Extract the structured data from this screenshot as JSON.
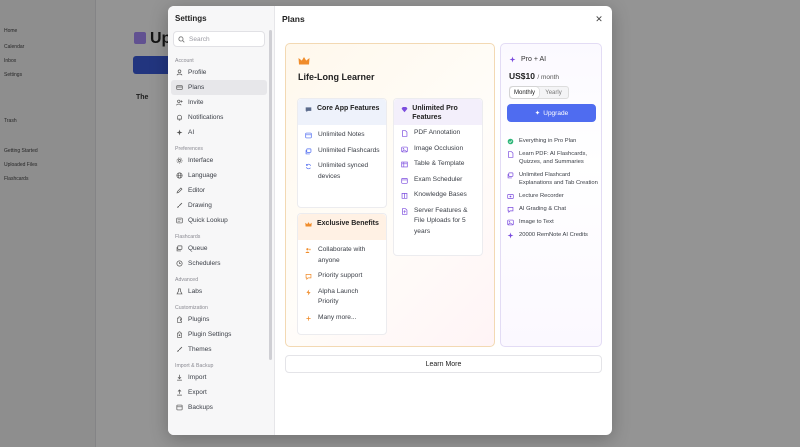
{
  "background": {
    "title": "Up",
    "subtitle": "The",
    "left_rows": [
      "",
      "Home",
      "Calendar",
      "Inbox",
      "Settings",
      "",
      "",
      "Trash",
      "",
      "",
      "Getting Started",
      "Uploaded Files",
      "Flashcards"
    ]
  },
  "settings": {
    "title": "Settings",
    "search_placeholder": "Search",
    "sections": [
      {
        "title": "Account",
        "items": [
          {
            "label": "Profile",
            "icon": "user-icon"
          },
          {
            "label": "Plans",
            "icon": "card-icon",
            "active": true
          },
          {
            "label": "Invite",
            "icon": "add-user-icon"
          },
          {
            "label": "Notifications",
            "icon": "bell-icon"
          },
          {
            "label": "AI",
            "icon": "sparkle-icon"
          }
        ]
      },
      {
        "title": "Preferences",
        "items": [
          {
            "label": "Interface",
            "icon": "settings-icon"
          },
          {
            "label": "Language",
            "icon": "globe-icon"
          },
          {
            "label": "Editor",
            "icon": "pen-icon"
          },
          {
            "label": "Drawing",
            "icon": "brush-icon"
          },
          {
            "label": "Quick Lookup",
            "icon": "lookup-icon"
          }
        ]
      },
      {
        "title": "Flashcards",
        "items": [
          {
            "label": "Queue",
            "icon": "queue-icon"
          },
          {
            "label": "Schedulers",
            "icon": "clock-icon"
          }
        ]
      },
      {
        "title": "Advanced",
        "items": [
          {
            "label": "Labs",
            "icon": "flask-icon"
          }
        ]
      },
      {
        "title": "Customization",
        "items": [
          {
            "label": "Plugins",
            "icon": "plugin-icon"
          },
          {
            "label": "Plugin Settings",
            "icon": "plugin-settings-icon"
          },
          {
            "label": "Themes",
            "icon": "brush-icon"
          }
        ]
      },
      {
        "title": "Import & Backup",
        "items": [
          {
            "label": "Import",
            "icon": "import-icon"
          },
          {
            "label": "Export",
            "icon": "export-icon"
          },
          {
            "label": "Backups",
            "icon": "backup-icon"
          }
        ]
      }
    ]
  },
  "plans": {
    "title": "Plans",
    "close_icon": "close-icon",
    "plan_name": "Life-Long Learner",
    "core": {
      "title": "Core App Features",
      "items": [
        "Unlimited Notes",
        "Unlimited Flashcards",
        "Unlimited synced devices"
      ]
    },
    "exclusive": {
      "title": "Exclusive Benefits",
      "items": [
        "Collaborate with anyone",
        "Priority support",
        "Alpha Launch Priority",
        "Many more..."
      ]
    },
    "pro": {
      "title": "Unlimited Pro Features",
      "items": [
        "PDF Annotation",
        "Image Occlusion",
        "Table & Template",
        "Exam Scheduler",
        "Knowledge Bases",
        "Server Features & File Uploads for 5 years"
      ]
    },
    "tier": {
      "name": "Pro + AI",
      "price": "US$10",
      "per": "/ month",
      "monthly": "Monthly",
      "yearly": "Yearly",
      "upgrade": "Upgrade",
      "features": [
        {
          "label": "Everything in Pro Plan",
          "icon": "check-circle-icon"
        },
        {
          "label": "Learn PDF: AI Flashcards, Quizzes, and Summaries",
          "icon": "pdf-icon"
        },
        {
          "label": "Unlimited Flashcard Explanations and Tab Creation",
          "icon": "flashcard-icon"
        },
        {
          "label": "Lecture Recorder",
          "icon": "recorder-icon"
        },
        {
          "label": "AI Grading & Chat",
          "icon": "chat-icon"
        },
        {
          "label": "Image to Text",
          "icon": "image-icon"
        },
        {
          "label": "20000 RemNote AI Credits",
          "icon": "sparkle-icon"
        }
      ]
    },
    "learn_more": "Learn More"
  },
  "colors": {
    "accent": "#4f6cf0",
    "crown": "#f08c2a",
    "purple": "#7c4dde"
  }
}
